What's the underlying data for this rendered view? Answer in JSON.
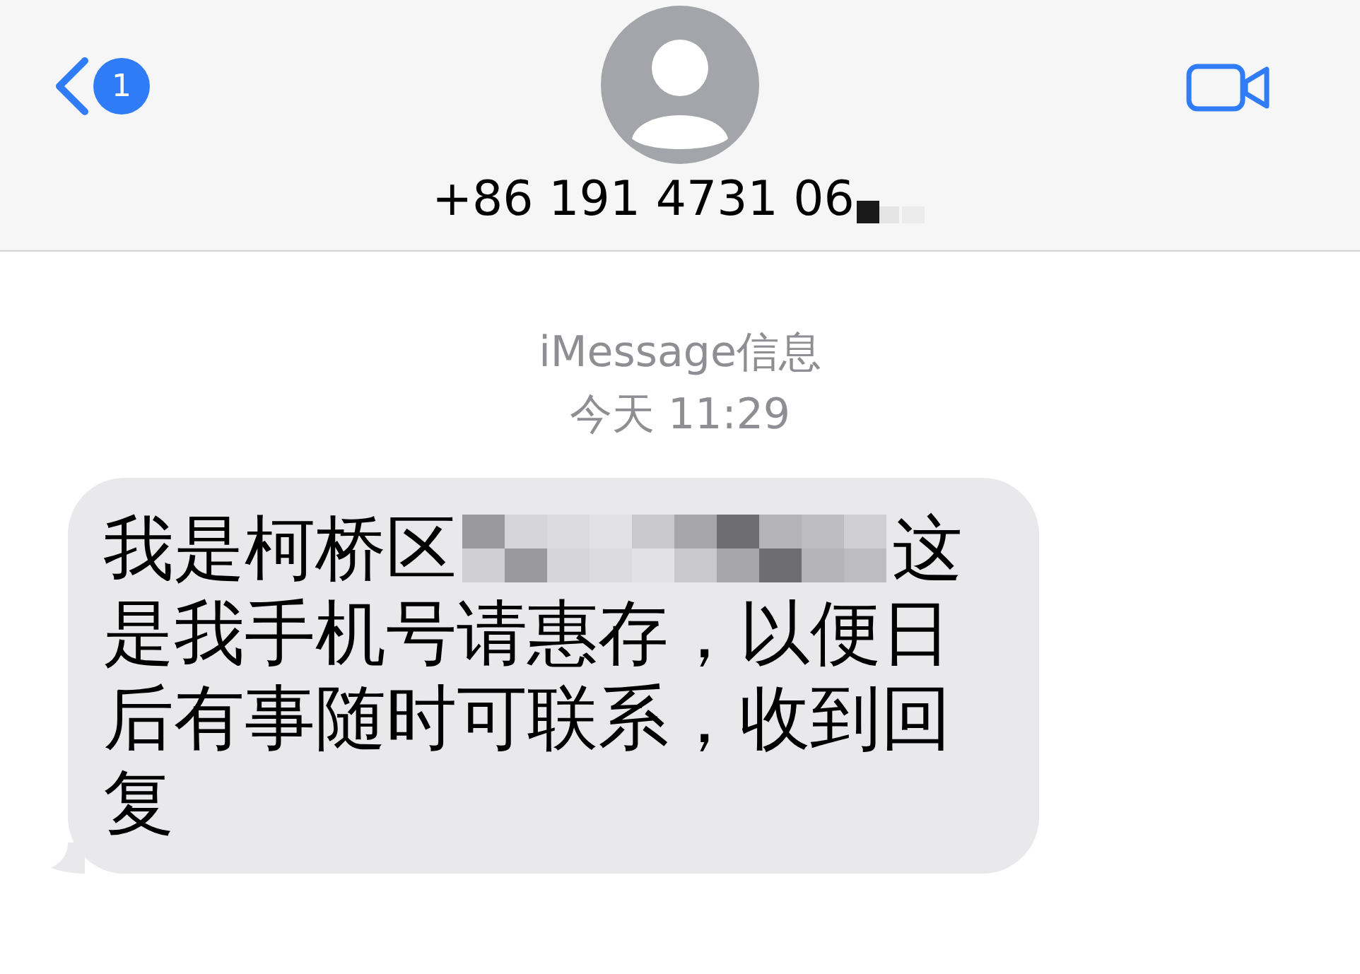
{
  "header": {
    "back_badge": "1",
    "contact": {
      "number": "+86 191 4731 06",
      "redacted": true
    }
  },
  "conversation": {
    "service_label": "iMessage信息",
    "timestamp": "今天 11:29",
    "messages": [
      {
        "kind": "incoming",
        "first_line": [
          {
            "kind": "text",
            "text": "我是柯桥区"
          },
          {
            "kind": "redacted"
          },
          {
            "kind": "text",
            "text": "这"
          }
        ],
        "rest": "是我手机号请惠存，以便日后有事随时可联系，收到回复"
      }
    ]
  }
}
